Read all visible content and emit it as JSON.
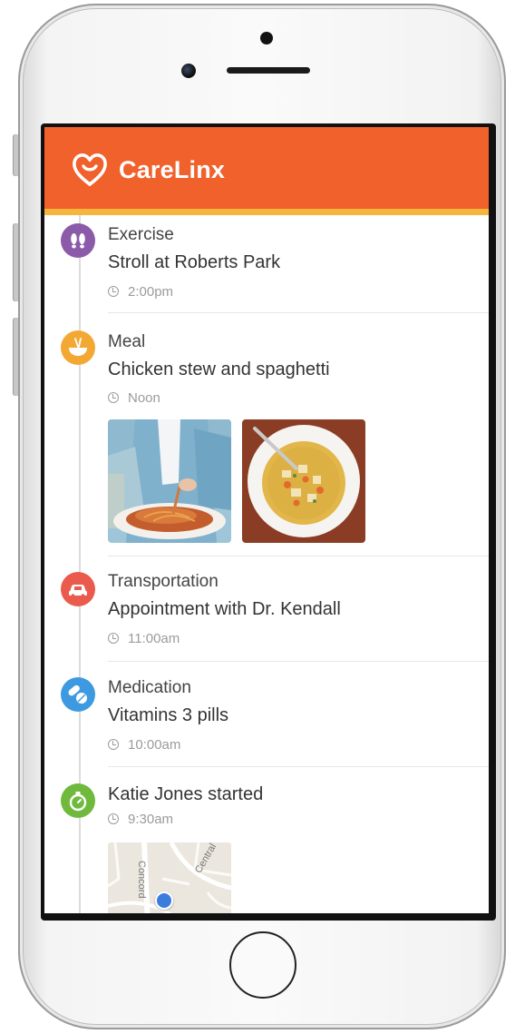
{
  "app": {
    "brand": "CareLinx",
    "brand_color": "#f0612c",
    "accent_stripe_color": "#f6b53d"
  },
  "entries": [
    {
      "category": "Exercise",
      "detail": "Stroll at Roberts Park",
      "time": "2:00pm",
      "icon": "footprints-icon",
      "color": "#8b5aa8"
    },
    {
      "category": "Meal",
      "detail": "Chicken stew and spaghetti",
      "time": "Noon",
      "icon": "bowl-icon",
      "color": "#f3a833",
      "photos": [
        "spaghetti-photo",
        "chicken-stew-photo"
      ]
    },
    {
      "category": "Transportation",
      "detail": "Appointment with Dr. Kendall",
      "time": "11:00am",
      "icon": "car-icon",
      "color": "#ea5b4d"
    },
    {
      "category": "Medication",
      "detail": "Vitamins 3 pills",
      "time": "10:00am",
      "icon": "pills-icon",
      "color": "#3d9ae0"
    },
    {
      "category": "Katie Jones started",
      "time": "9:30am",
      "icon": "stopwatch-icon",
      "color": "#6fba3c",
      "map_labels": [
        "Concord",
        "Central"
      ]
    }
  ]
}
